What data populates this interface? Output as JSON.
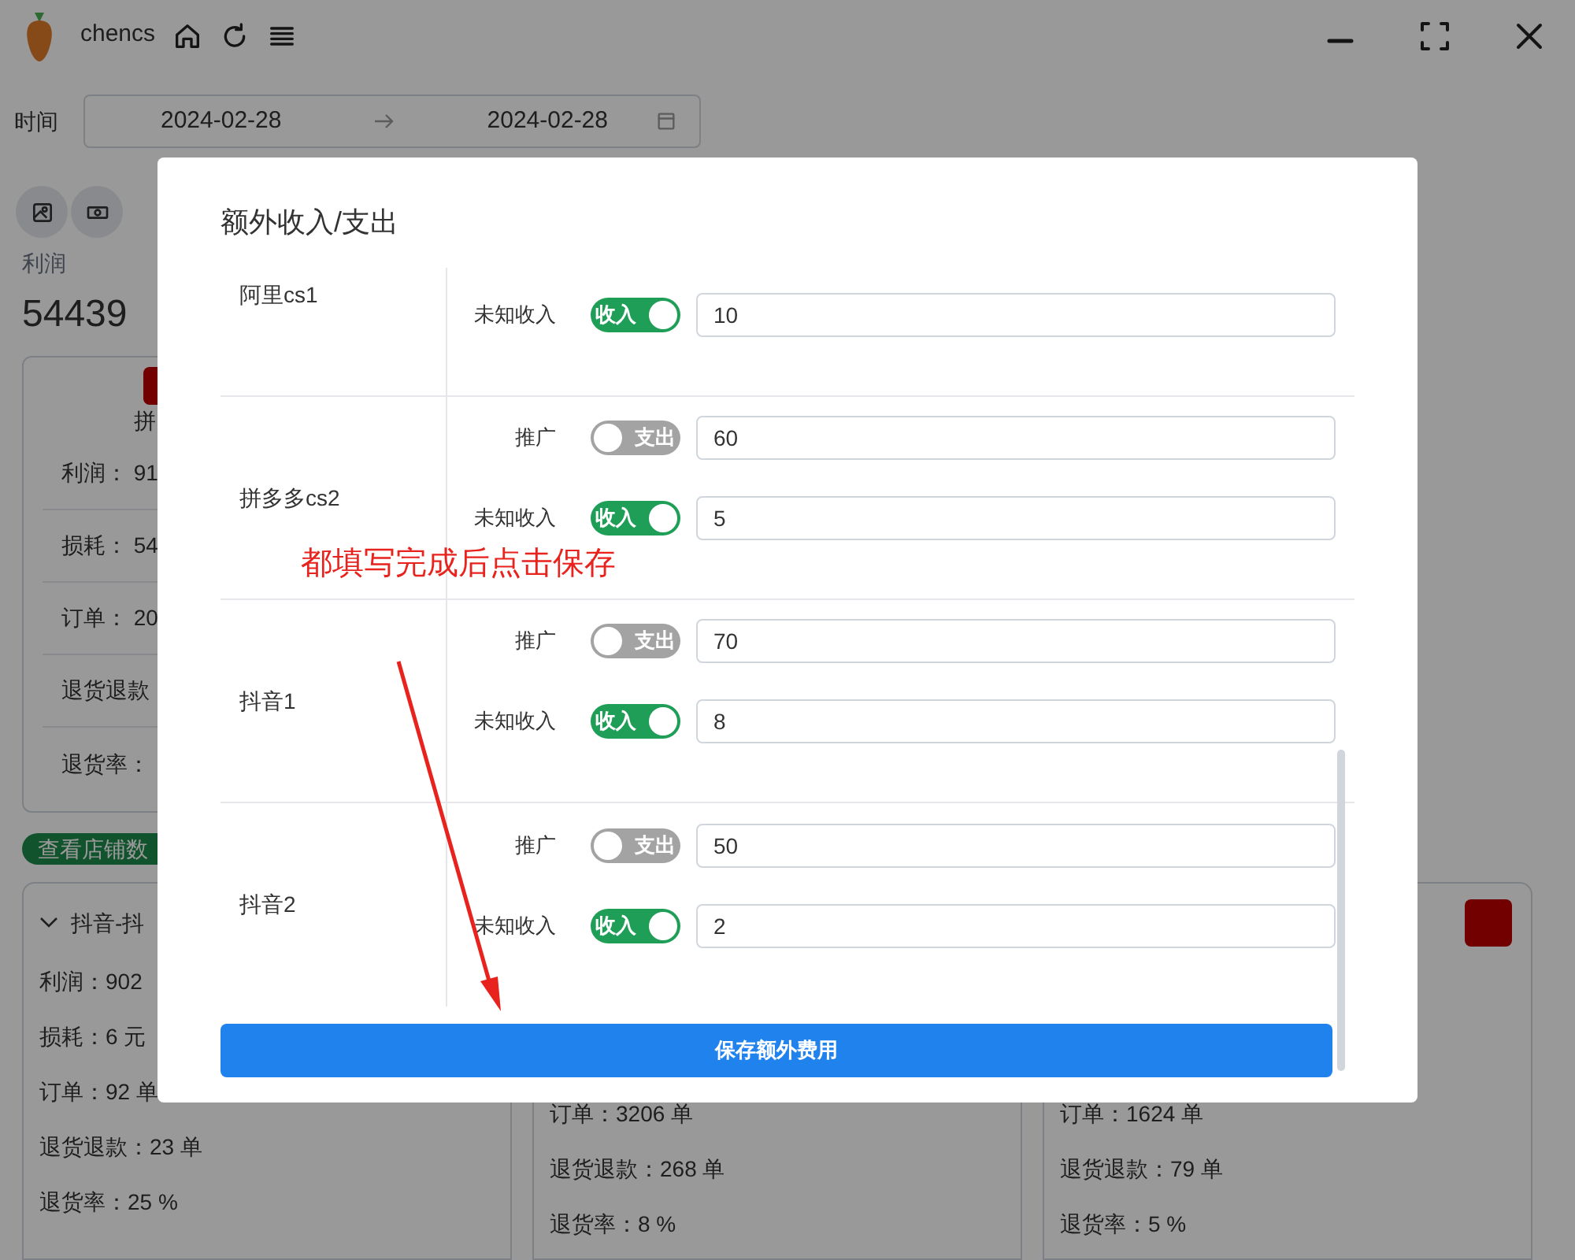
{
  "app": {
    "user": "chencs"
  },
  "filter": {
    "label": "时间",
    "start": "2024-02-28",
    "end": "2024-02-28"
  },
  "summary": {
    "label": "利润",
    "value": "54439"
  },
  "shop_card": {
    "name": "拼",
    "stats": [
      "利润： 91",
      "损耗： 54",
      "订单： 20",
      "退货退款",
      "退货率："
    ]
  },
  "view_button": "查看店铺数",
  "shop_cards": [
    {
      "header": "抖音-抖",
      "logo": false,
      "stats": [
        "利润：902",
        "损耗：6 元",
        "订单：92 单",
        "退货退款：23 单",
        "退货率：25 %"
      ]
    },
    {
      "logo": false,
      "stats": [
        "订单：3206 单",
        "退货退款：268 单",
        "退货率：8 %"
      ]
    },
    {
      "logo": true,
      "stats": [
        "订单：1624 单",
        "退货退款：79 单",
        "退货率：5 %"
      ]
    }
  ],
  "dialog": {
    "title": "额外收入/支出",
    "groups": [
      {
        "name": "阿里cs1",
        "items": [
          {
            "label": "未知收入",
            "on": true,
            "toggle_text": "收入",
            "value": "10"
          }
        ]
      },
      {
        "name": "拼多多cs2",
        "items": [
          {
            "label": "推广",
            "on": false,
            "toggle_text": "支出",
            "value": "60"
          },
          {
            "label": "未知收入",
            "on": true,
            "toggle_text": "收入",
            "value": "5"
          }
        ]
      },
      {
        "name": "抖音1",
        "items": [
          {
            "label": "推广",
            "on": false,
            "toggle_text": "支出",
            "value": "70"
          },
          {
            "label": "未知收入",
            "on": true,
            "toggle_text": "收入",
            "value": "8"
          }
        ]
      },
      {
        "name": "抖音2",
        "items": [
          {
            "label": "推广",
            "on": false,
            "toggle_text": "支出",
            "value": "50"
          },
          {
            "label": "未知收入",
            "on": true,
            "toggle_text": "收入",
            "value": "2"
          }
        ]
      }
    ],
    "save_button": "保存额外费用"
  },
  "annotation": {
    "text": "都填写完成后点击保存"
  }
}
